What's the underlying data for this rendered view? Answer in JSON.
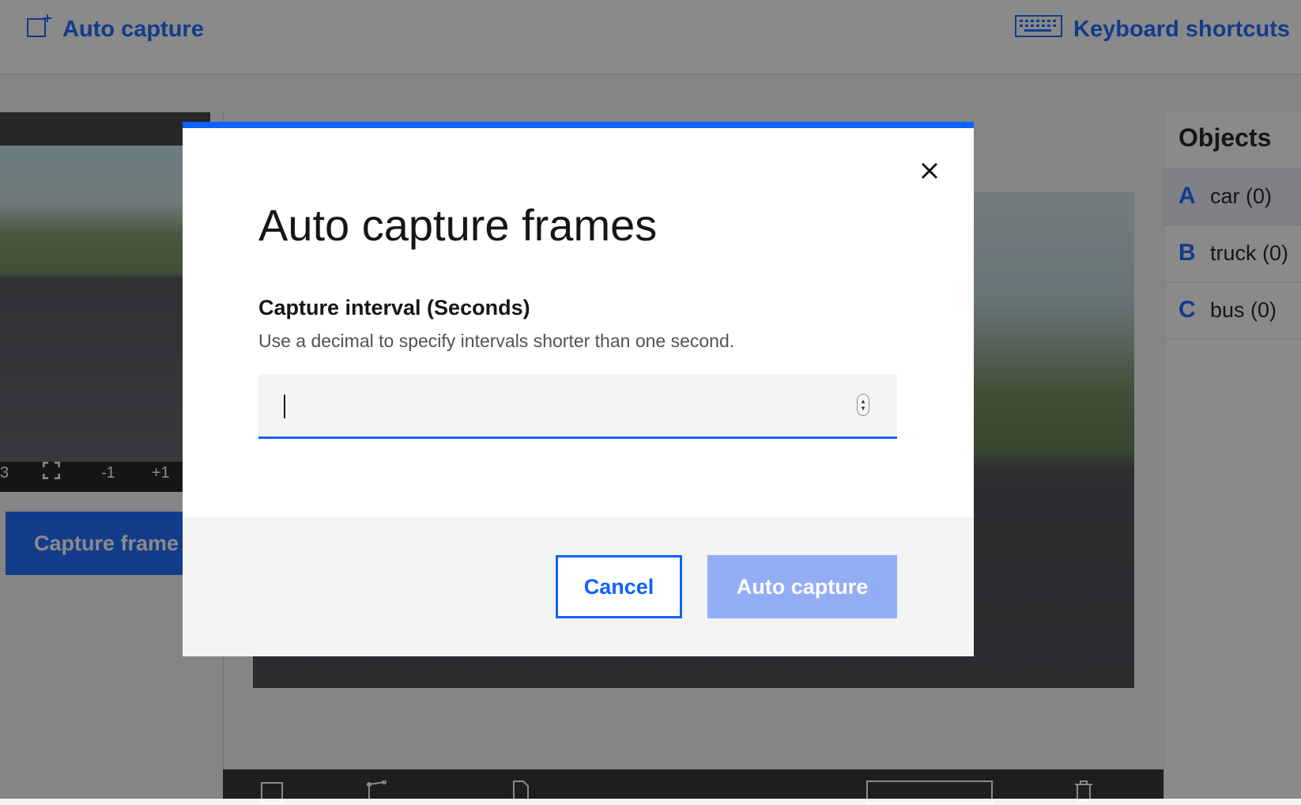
{
  "topbar": {
    "auto_capture_label": "Auto capture",
    "keyboard_shortcuts_label": "Keyboard shortcuts"
  },
  "left_panel": {
    "controls": [
      "3",
      "-1",
      "+1"
    ],
    "capture_button_label": "Capture frame"
  },
  "objects": {
    "title": "Objects",
    "items": [
      {
        "key": "A",
        "label": "car (0)"
      },
      {
        "key": "B",
        "label": "truck (0)"
      },
      {
        "key": "C",
        "label": "bus (0)"
      }
    ]
  },
  "modal": {
    "title": "Auto capture frames",
    "field_label": "Capture interval (Seconds)",
    "field_help": "Use a decimal to specify intervals shorter than one second.",
    "field_value": "",
    "cancel_label": "Cancel",
    "primary_label": "Auto capture"
  },
  "colors": {
    "accent": "#0f62fe",
    "primary_disabled": "#93adf5",
    "overlay": "rgba(22,22,22,0.5)"
  }
}
